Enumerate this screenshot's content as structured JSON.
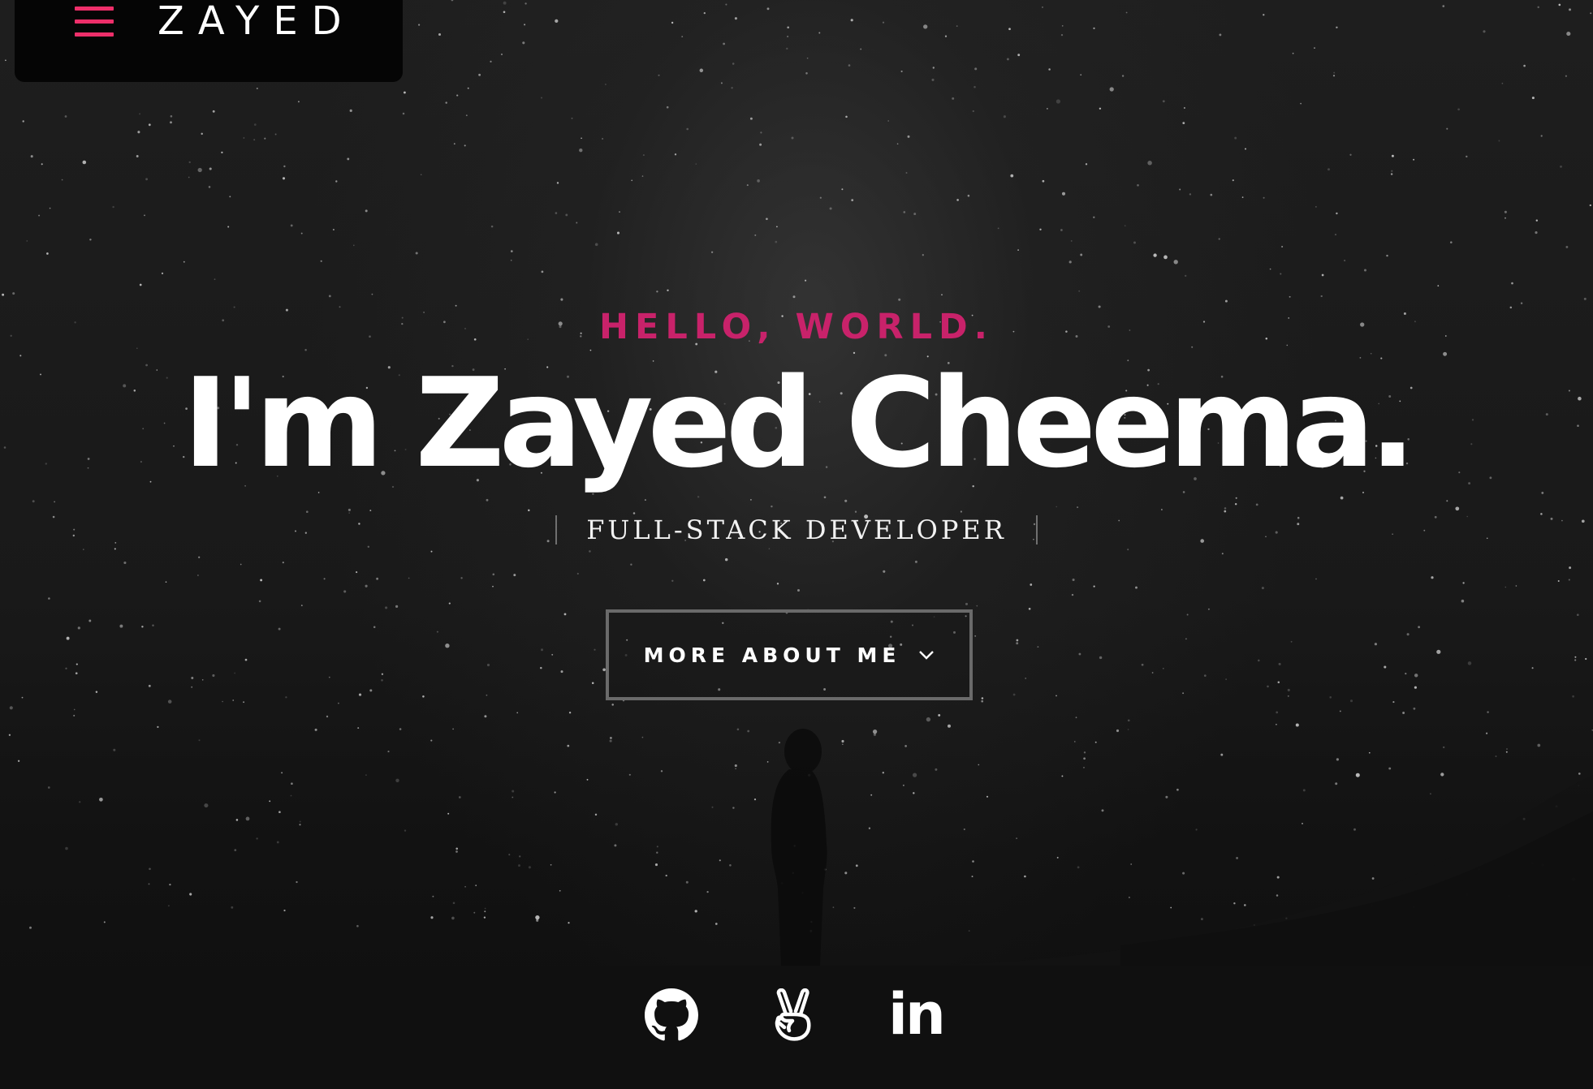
{
  "header": {
    "menu_icon": "hamburger-menu-icon",
    "logo": "ZAYED"
  },
  "hero": {
    "greeting": "HELLO, WORLD.",
    "name": "I'm Zayed Cheema.",
    "role": "FULL-STACK DEVELOPER",
    "cta_label": "MORE ABOUT ME",
    "cta_icon": "chevron-down-icon"
  },
  "socials": {
    "items": [
      {
        "icon": "github-icon"
      },
      {
        "icon": "angellist-icon"
      },
      {
        "icon": "linkedin-icon",
        "label": "in"
      }
    ]
  },
  "colors": {
    "accent": "#ee2f6a",
    "greeting": "#c8226a",
    "background": "#111111",
    "text": "#ffffff"
  }
}
